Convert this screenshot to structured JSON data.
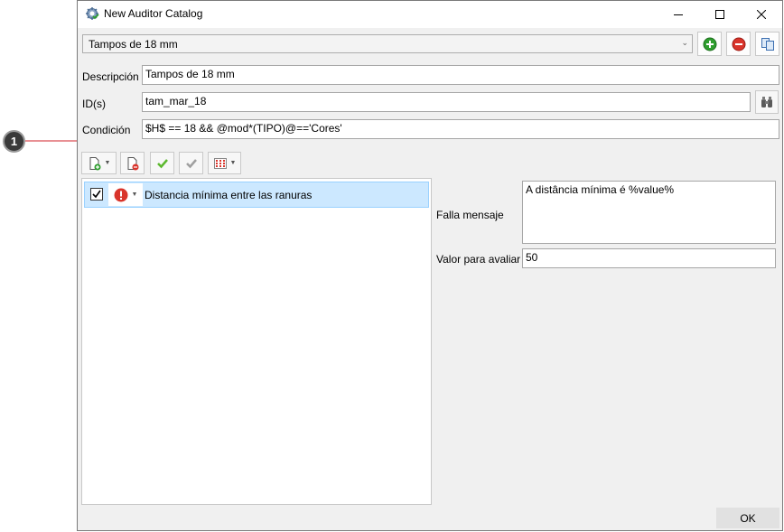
{
  "window": {
    "title": "New Auditor Catalog",
    "icon": "gear-check-icon"
  },
  "catalog": {
    "selected": "Tampos de 18 mm"
  },
  "form": {
    "description_label": "Descripción",
    "description_value": "Tampos de 18 mm",
    "ids_label": "ID(s)",
    "ids_value": "tam_mar_18",
    "condition_label": "Condición",
    "condition_value": "$H$ == 18 && @mod*(TIPO)@=='Cores'"
  },
  "rules": [
    {
      "checked": true,
      "severity": "error",
      "label": "Distancia mínima entre las ranuras"
    }
  ],
  "detail": {
    "message_label": "Falla mensaje",
    "message_value": "A distância mínima é %value%",
    "value_label": "Valor para avaliar",
    "value_value": "50"
  },
  "footer": {
    "ok_label": "OK"
  },
  "callout": {
    "number": "1",
    "color": "#d0202a"
  },
  "colors": {
    "add": "#2e9e2e",
    "remove": "#d9342b",
    "selection": "#cce8ff"
  }
}
